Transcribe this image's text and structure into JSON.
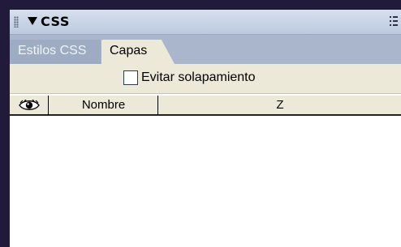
{
  "panel": {
    "title": "CSS",
    "icons": {
      "grip": "grip-handle-icon",
      "collapse": "collapse-arrow-icon",
      "options": "panel-options-icon"
    }
  },
  "tabs": [
    {
      "label": "Estilos CSS",
      "active": false
    },
    {
      "label": "Capas",
      "active": true
    }
  ],
  "options": {
    "prevent_overlap_label": "Evitar solapamiento",
    "prevent_overlap_checked": false
  },
  "table": {
    "columns": [
      {
        "label": "",
        "icon": "eye-icon"
      },
      {
        "label": "Nombre"
      },
      {
        "label": "Z"
      }
    ],
    "rows": []
  },
  "colors": {
    "titlebar": "#c8d3e6",
    "tabbar": "#a9b6cc",
    "active_tab": "#ece9d8",
    "backdrop": "#221a3a"
  }
}
